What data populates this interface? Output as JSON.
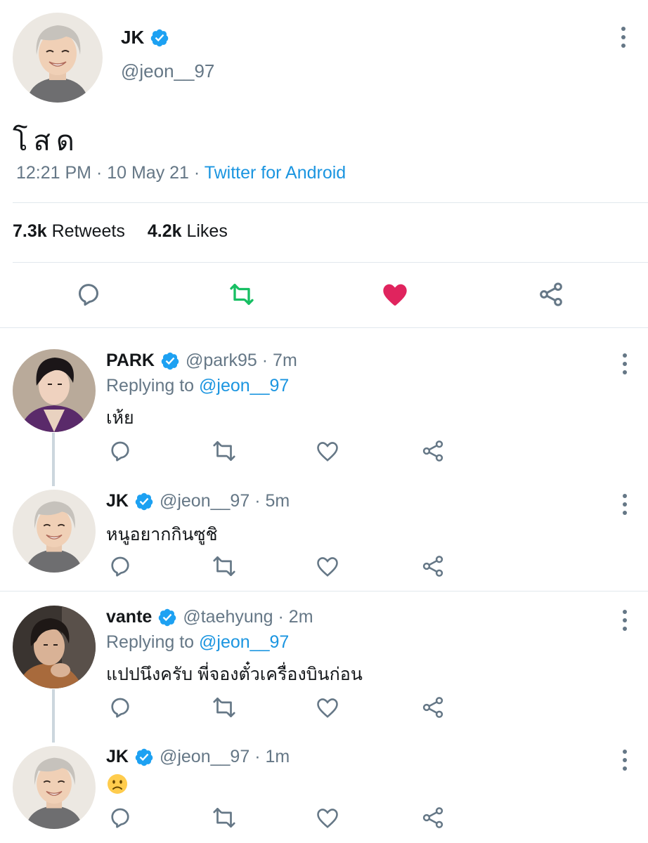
{
  "main_tweet": {
    "name": "JK",
    "handle": "@jeon__97",
    "text": "โสด",
    "time": "12:21 PM · 10 May 21 · ",
    "source": "Twitter for Android",
    "retweets_count": "7.3k",
    "retweets_label": "Retweets",
    "likes_count": "4.2k",
    "likes_label": "Likes",
    "liked": true
  },
  "replies": [
    {
      "name": "PARK",
      "handle": "@park95",
      "time": "· 7m",
      "replying_prefix": "Replying to ",
      "replying_to": "@jeon__97",
      "text": "เห้ย"
    },
    {
      "name": "JK",
      "handle": "@jeon__97",
      "time": "· 5m",
      "text": "หนูอยากกินซูชิ"
    },
    {
      "name": "vante",
      "handle": "@taehyung",
      "time": "· 2m",
      "replying_prefix": "Replying to ",
      "replying_to": "@jeon__97",
      "text": "แปปนึงครับ พี่จองตั๋วเครื่องบินก่อน"
    },
    {
      "name": "JK",
      "handle": "@jeon__97",
      "time": "· 1m",
      "text": "🙁"
    }
  ],
  "colors": {
    "accent": "#1b95e0",
    "verified": "#1da1f2",
    "retweet": "#17bf63",
    "like": "#e0245e",
    "muted": "#657786"
  }
}
